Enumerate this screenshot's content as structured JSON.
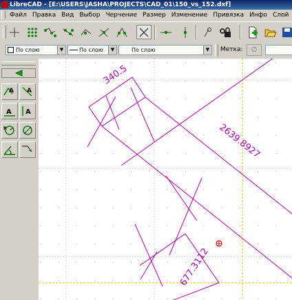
{
  "window": {
    "title": "LibreCAD - [E:\\USERS\\JASHA\\PROJECTS\\CAD_01\\150_vs_152.dxf]"
  },
  "menu": [
    "Файл",
    "Правка",
    "Вид",
    "Выбор",
    "Черчение",
    "Размер",
    "Изменение",
    "Привязка",
    "Инфо",
    "Слой"
  ],
  "properties": {
    "color": "По слою",
    "linetype": "По слою",
    "linewidth": "По слою",
    "label": "Метка:",
    "label_value": "",
    "clear_glyph": "∅"
  },
  "drawing": {
    "dim_top": "340.5",
    "dim_diagonal": "2639.8927",
    "dim_bottom": "677.3112"
  },
  "colors": {
    "entity": "#b000b0",
    "grid_dot": "#a0a0a0",
    "crosshair": "#e0c000",
    "marker": "#e01010"
  }
}
